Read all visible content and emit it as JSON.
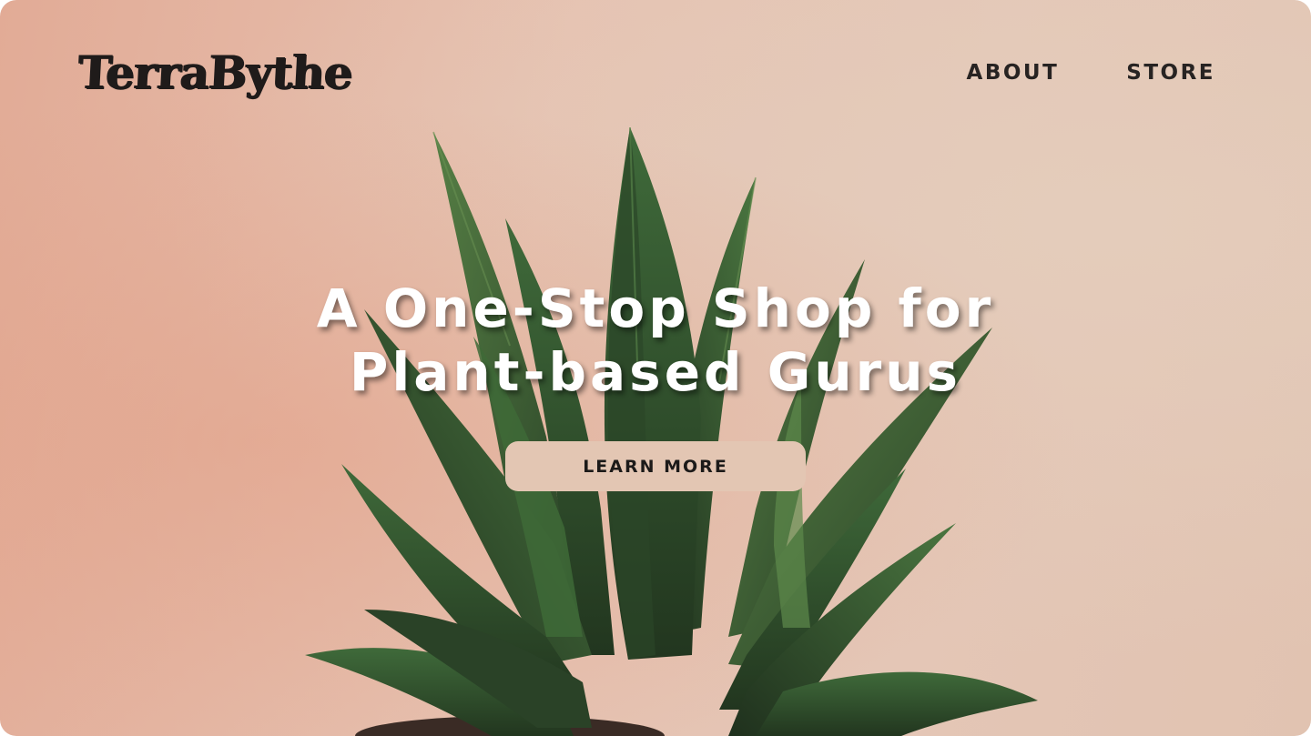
{
  "brand": {
    "logo_text": "TerraBythe"
  },
  "nav": {
    "items": [
      {
        "label": "ABOUT"
      },
      {
        "label": "STORE"
      }
    ]
  },
  "hero": {
    "title_line1": "A One-Stop Shop for",
    "title_line2": "Plant-based Gurus",
    "cta_label": "LEARN MORE",
    "background_image": "agave-succulent-plant-on-peach-wall"
  },
  "colors": {
    "background": "#e4c3b1",
    "text_dark": "#1f1b1a",
    "hero_text": "#ffffff",
    "cta_background": "#e3c6b3",
    "plant_green": "#2f4a2f"
  }
}
